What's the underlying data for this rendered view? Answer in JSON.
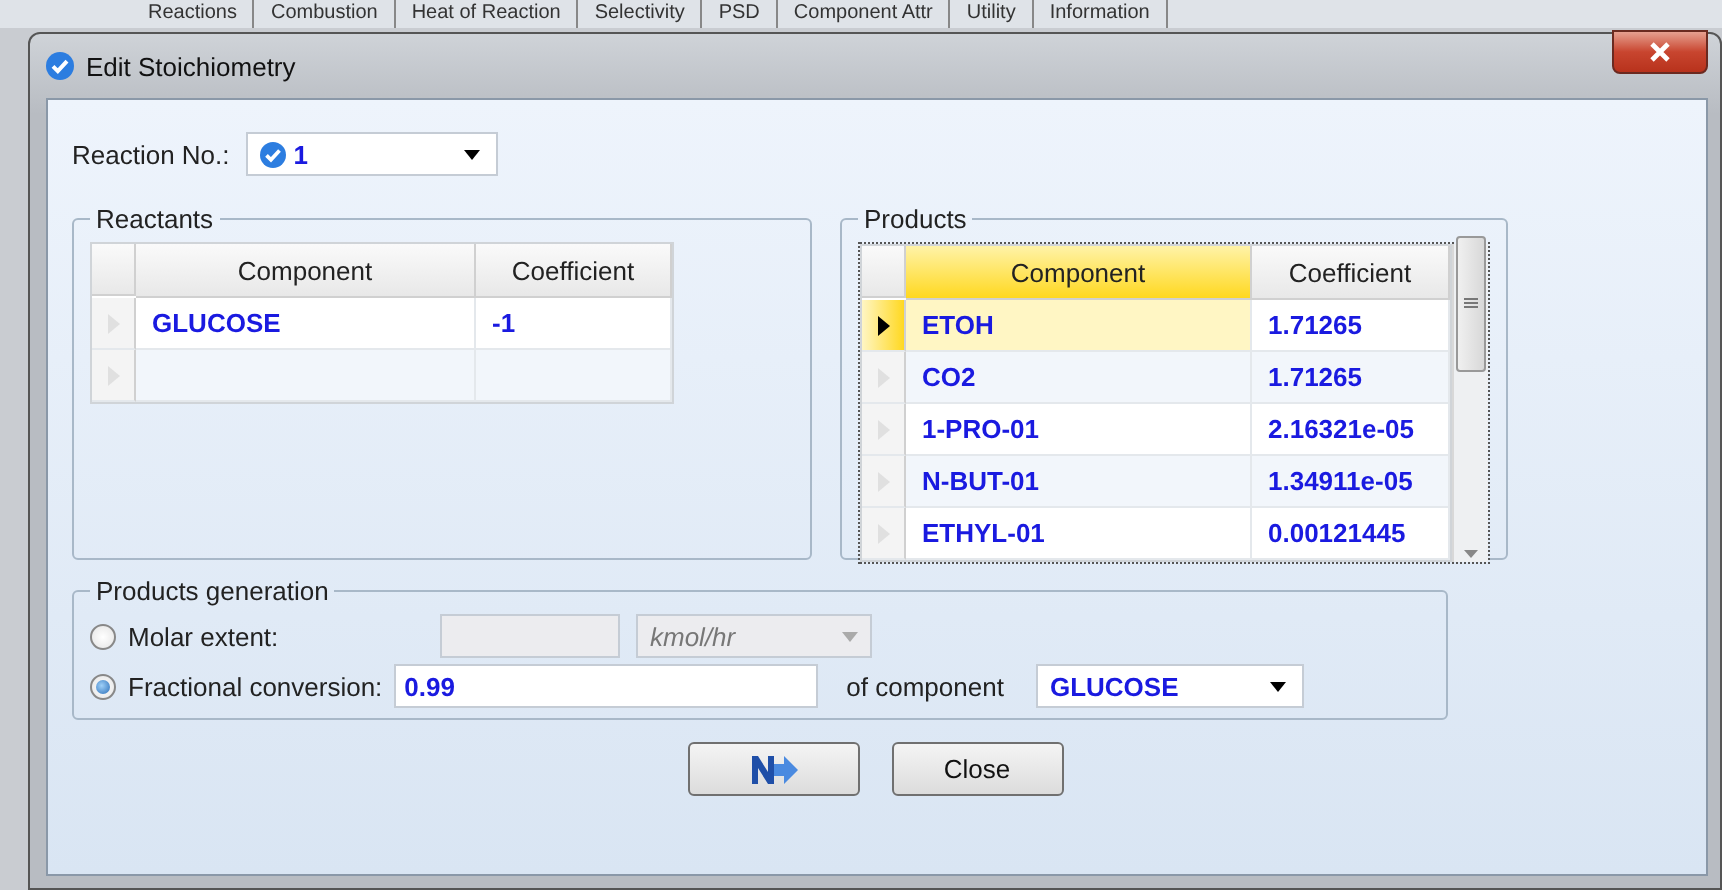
{
  "background_tabs": [
    {
      "label": "Reactions"
    },
    {
      "label": "Combustion"
    },
    {
      "label": "Heat of Reaction"
    },
    {
      "label": "Selectivity"
    },
    {
      "label": "PSD"
    },
    {
      "label": "Component Attr"
    },
    {
      "label": "Utility"
    },
    {
      "label": "Information"
    }
  ],
  "window": {
    "title": "Edit Stoichiometry"
  },
  "reaction_no": {
    "label": "Reaction No.:",
    "value": "1"
  },
  "reactants": {
    "title": "Reactants",
    "columns": [
      "Component",
      "Coefficient"
    ],
    "rows": [
      {
        "component": "GLUCOSE",
        "coefficient": "-1",
        "selected": false
      }
    ]
  },
  "products": {
    "title": "Products",
    "columns": [
      "Component",
      "Coefficient"
    ],
    "rows": [
      {
        "component": "ETOH",
        "coefficient": "1.71265",
        "selected": true
      },
      {
        "component": "CO2",
        "coefficient": "1.71265",
        "selected": false
      },
      {
        "component": "1-PRO-01",
        "coefficient": "2.16321e-05",
        "selected": false
      },
      {
        "component": "N-BUT-01",
        "coefficient": "1.34911e-05",
        "selected": false
      },
      {
        "component": "ETHYL-01",
        "coefficient": "0.00121445",
        "selected": false
      }
    ]
  },
  "generation": {
    "title": "Products generation",
    "options": [
      {
        "kind": "extent",
        "label": "Molar extent:",
        "selected": false,
        "unit": "kmol/hr"
      },
      {
        "kind": "conversion",
        "label": "Fractional conversion:",
        "selected": true,
        "value": "0.99",
        "component_label": "of component",
        "component": "GLUCOSE"
      }
    ]
  },
  "buttons": [
    {
      "kind": "icon"
    },
    {
      "kind": "text",
      "label": "Close"
    }
  ]
}
